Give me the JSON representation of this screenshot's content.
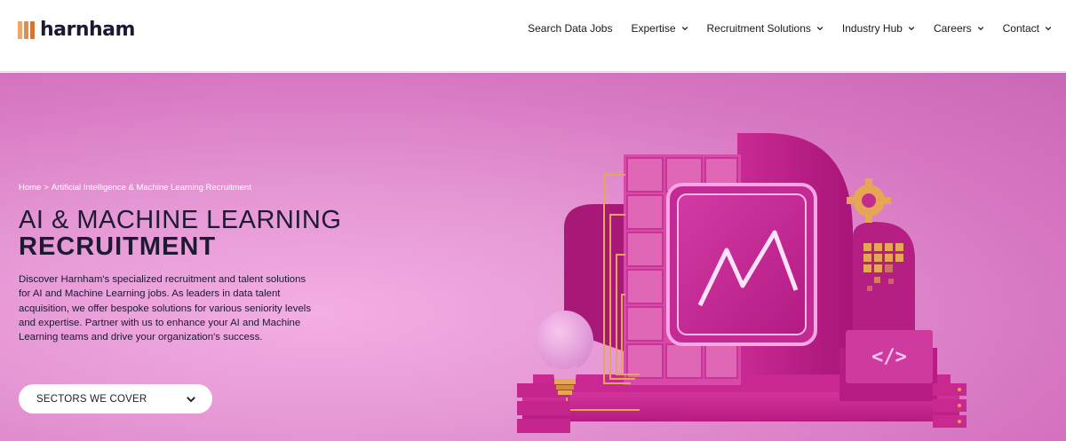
{
  "brand": {
    "name": "harnham"
  },
  "nav": {
    "items": [
      {
        "label": "Search Data Jobs",
        "has_dropdown": false
      },
      {
        "label": "Expertise",
        "has_dropdown": true
      },
      {
        "label": "Recruitment Solutions",
        "has_dropdown": true
      },
      {
        "label": "Industry Hub",
        "has_dropdown": true
      },
      {
        "label": "Careers",
        "has_dropdown": true
      },
      {
        "label": "Contact",
        "has_dropdown": true
      }
    ]
  },
  "hero": {
    "breadcrumb": {
      "home": "Home",
      "separator": ">",
      "current": "Artificial Intelligence & Machine Learning Recruitment"
    },
    "title_line1": "AI & MACHINE LEARNING",
    "title_line2": "RECRUITMENT",
    "description": "Discover Harnham's specialized recruitment and talent solutions for AI and Machine Learning jobs. As leaders in data talent acquisition, we offer bespoke solutions for various seniority levels and expertise. Partner with us to enhance your AI and Machine Learning teams and drive your organization's success.",
    "sectors_button": "SECTORS WE COVER",
    "illustration_code_symbol": "</>"
  },
  "colors": {
    "hero_bg": "#e597d4",
    "brand_dark": "#1b1935",
    "logo_orange": "#e48a4a",
    "illustration_magenta": "#c0268f"
  }
}
